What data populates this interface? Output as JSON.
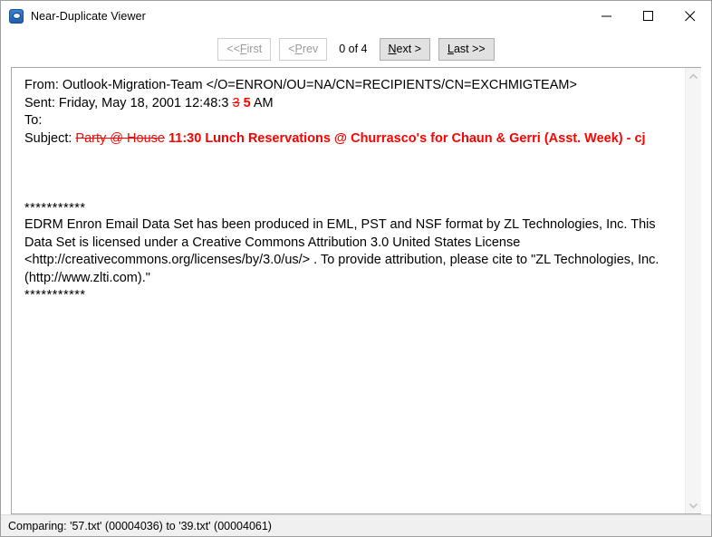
{
  "window": {
    "title": "Near-Duplicate Viewer",
    "icon": "app-globe-icon",
    "controls": {
      "minimize": "minimize-icon",
      "maximize": "maximize-icon",
      "close": "close-icon"
    }
  },
  "toolbar": {
    "first_label": "<< First",
    "first_pre": "<< ",
    "first_acc": "F",
    "first_post": "irst",
    "prev_pre": "< ",
    "prev_acc": "P",
    "prev_post": "rev",
    "page_indicator": "0 of 4",
    "next_acc": "N",
    "next_post": "ext >",
    "last_acc": "L",
    "last_post": "ast >>",
    "first_enabled": false,
    "prev_enabled": false,
    "next_enabled": true,
    "last_enabled": true
  },
  "document": {
    "from_label": "From: ",
    "from_value": "Outlook-Migration-Team </O=ENRON/OU=NA/CN=RECIPIENTS/CN=EXCHMIGTEAM>",
    "sent_label": "Sent: ",
    "sent_value_plain": "Friday, May 18, 2001 12:48:3",
    "sent_value_deleted": "3",
    "sent_value_inserted": "5",
    "sent_value_tail": " AM",
    "to_label": "To:",
    "to_value": "",
    "subject_label": "Subject: ",
    "subject_deleted": "Party @ House",
    "subject_inserted": "11:30 Lunch Reservations @ Churrasco's for Chaun & Gerri (Asst. Week) - cj",
    "stars_top": "***********",
    "body_paragraph": "EDRM Enron Email Data Set has been produced in EML, PST and NSF format by ZL Technologies, Inc. This Data Set is licensed under a Creative Commons Attribution 3.0 United States License <http://creativecommons.org/licenses/by/3.0/us/> . To provide attribution, please cite to \"ZL Technologies, Inc. (http://www.zlti.com).\"",
    "stars_bottom": "***********"
  },
  "scrollbar": {
    "up_arrow": "chevron-up-icon",
    "down_arrow": "chevron-down-icon"
  },
  "statusbar": {
    "text": "Comparing: '57.txt' (00004036) to '39.txt' (00004061)"
  },
  "colors": {
    "diff_red": "#ff0000",
    "button_face": "#e1e1e1",
    "button_border": "#adadad",
    "statusbar_bg": "#f0f0f0",
    "panel_border": "#a7a7a7"
  }
}
